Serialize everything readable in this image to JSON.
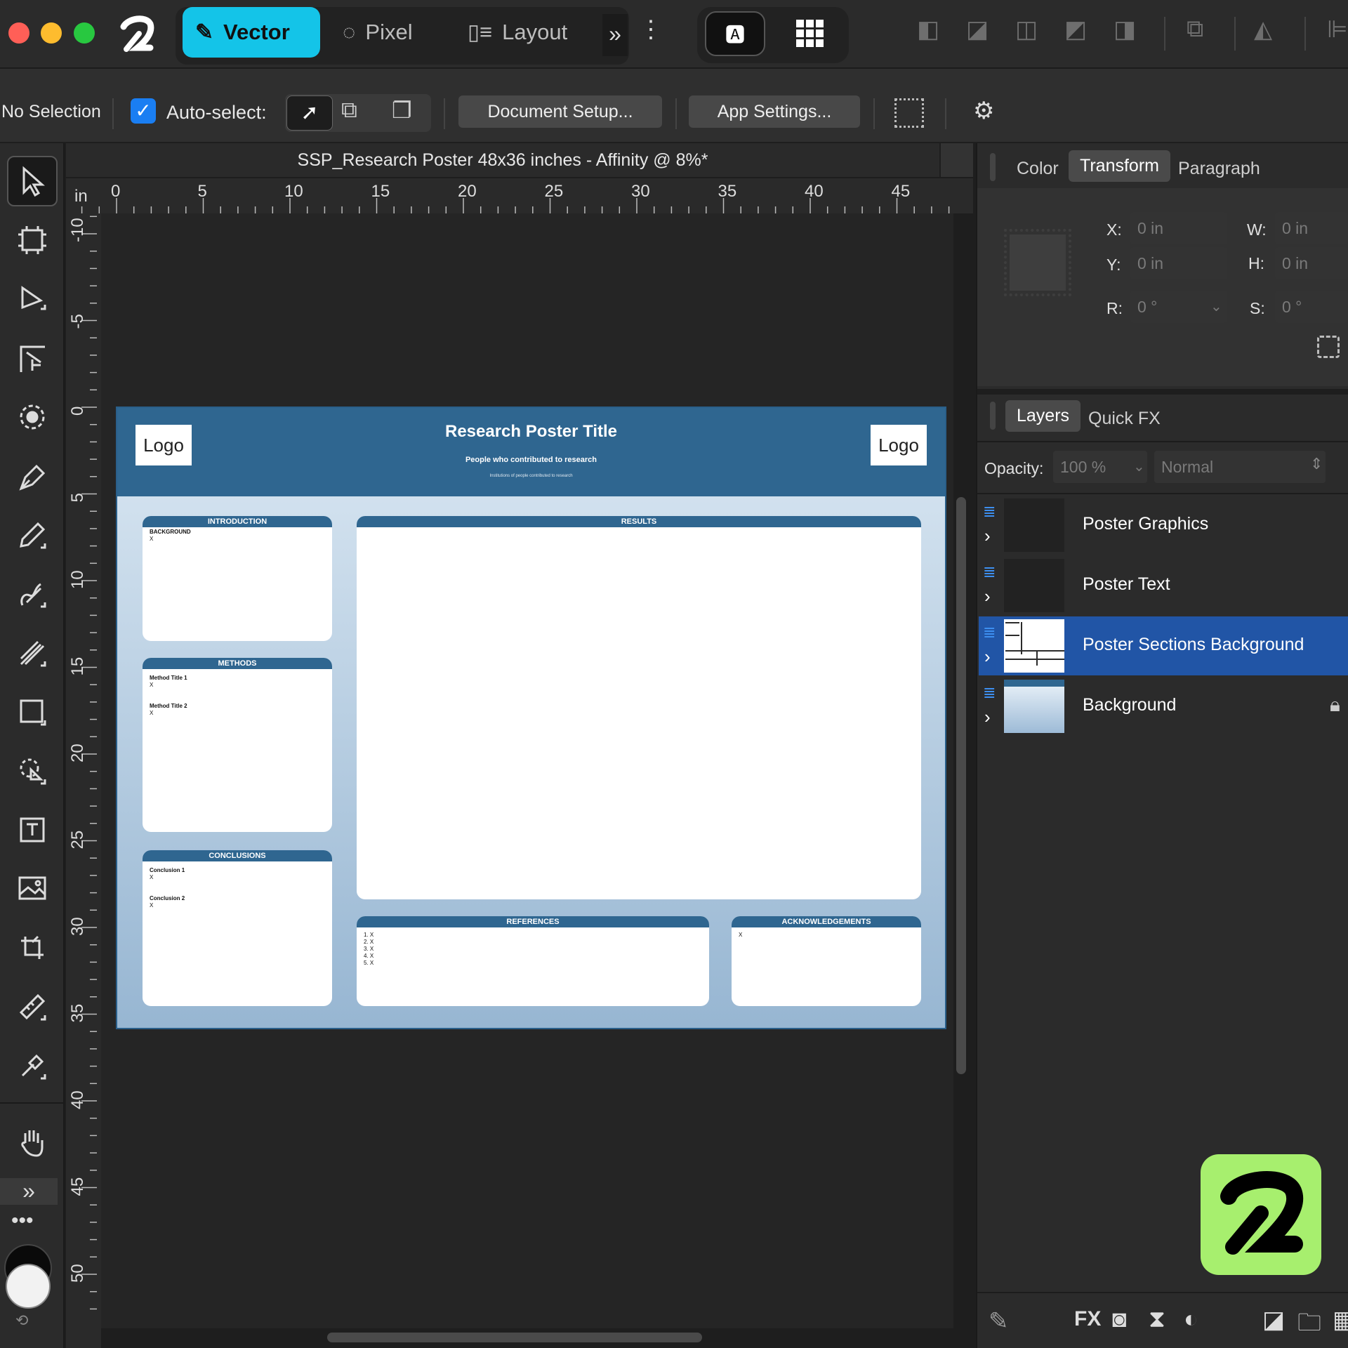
{
  "app": {
    "modes": [
      "Vector",
      "Pixel",
      "Layout"
    ],
    "active_mode": "Vector"
  },
  "context_bar": {
    "selection": "No Selection",
    "autoselect_label": "Auto-select:",
    "document_setup": "Document Setup...",
    "app_settings": "App Settings..."
  },
  "document": {
    "title": "SSP_Research Poster 48x36 inches - Affinity @ 8%*",
    "ruler_unit": "in",
    "h_ticks": [
      "0",
      "5",
      "10",
      "15",
      "20",
      "25",
      "30",
      "35",
      "40",
      "45"
    ],
    "v_ticks": [
      "-10",
      "-5",
      "0",
      "5",
      "10",
      "15",
      "20",
      "25",
      "30",
      "35",
      "40",
      "45",
      "50"
    ]
  },
  "poster": {
    "title": "Research Poster Title",
    "authors": "People who contributed to research",
    "institutions": "Institutions of people contributed to research",
    "logo_left": "Logo",
    "logo_right": "Logo",
    "sections": {
      "introduction": {
        "head": "INTRODUCTION",
        "lines": [
          "BACKGROUND",
          "X"
        ]
      },
      "methods": {
        "head": "METHODS",
        "lines": [
          "Method Title 1",
          "X",
          "",
          "Method Title 2",
          "X"
        ]
      },
      "conclusions": {
        "head": "CONCLUSIONS",
        "lines": [
          "Conclusion 1",
          "X",
          "",
          "Conclusion 2",
          "X"
        ]
      },
      "results": {
        "head": "RESULTS"
      },
      "references": {
        "head": "REFERENCES",
        "lines": [
          "1. X",
          "2. X",
          "3. X",
          "4. X",
          "5. X"
        ]
      },
      "acknowledgements": {
        "head": "ACKNOWLEDGEMENTS",
        "lines": [
          "X"
        ]
      }
    }
  },
  "right_panel": {
    "top_tabs": [
      "Color",
      "Transform",
      "Paragraph"
    ],
    "active_top_tab": "Transform",
    "transform": {
      "x_label": "X:",
      "x_value": "0 in",
      "y_label": "Y:",
      "y_value": "0 in",
      "w_label": "W:",
      "w_value": "0 in",
      "h_label": "H:",
      "h_value": "0 in",
      "r_label": "R:",
      "r_value": "0 °",
      "s_label": "S:",
      "s_value": "0 °"
    },
    "layer_tabs": [
      "Layers",
      "Quick FX"
    ],
    "active_layer_tab": "Layers",
    "opacity_label": "Opacity:",
    "opacity_value": "100 %",
    "blend_mode": "Normal",
    "layers": [
      {
        "name": "Poster Graphics",
        "selected": false,
        "locked": false
      },
      {
        "name": "Poster Text",
        "selected": false,
        "locked": false
      },
      {
        "name": "Poster Sections Background",
        "selected": true,
        "locked": false
      },
      {
        "name": "Background",
        "selected": false,
        "locked": true
      }
    ]
  },
  "colors": {
    "accent": "#14c4e8",
    "selection": "#2155a6",
    "poster_header": "#2f6690",
    "brand_green": "#a7ef6e"
  }
}
